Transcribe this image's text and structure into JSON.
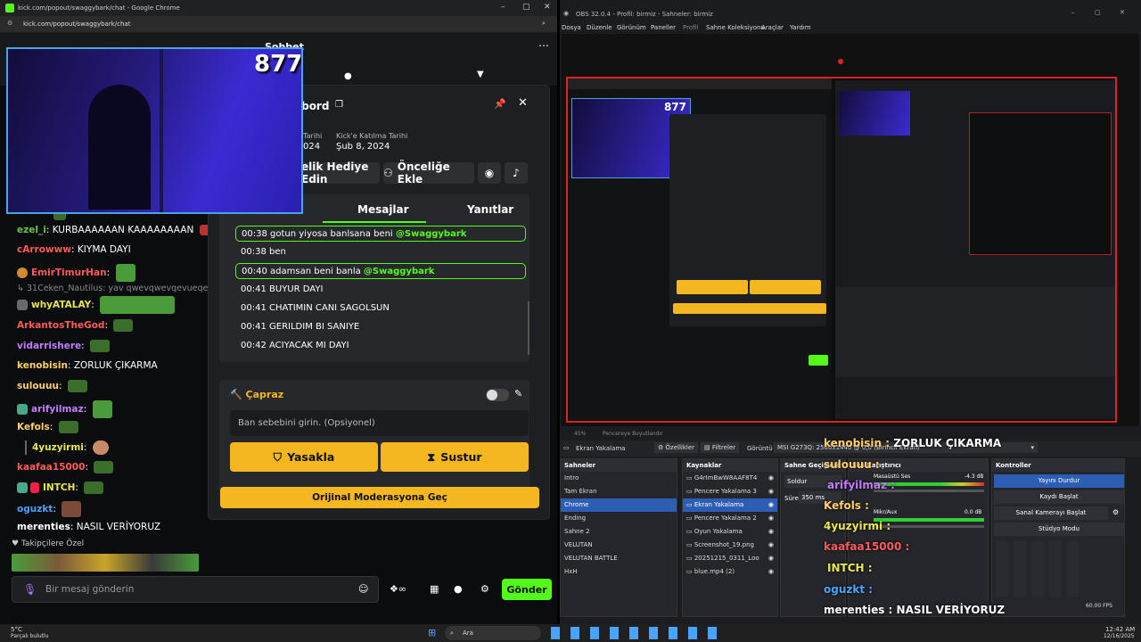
{
  "chrome": {
    "title": "kick.com/popout/swaggybark/chat - Google Chrome",
    "url": "kick.com/popout/swaggybark/chat"
  },
  "kick": {
    "chat_title": "Sohbet",
    "viewer_count": "877",
    "profile": {
      "username_partial": "abord",
      "join_label": "Kick'e Katılma Tarihi",
      "join_date": "Şub 8, 2024",
      "prev_label_partial": "Tarihi",
      "prev_value_partial": "024"
    },
    "actions": {
      "gift": "elik Hediye Edin",
      "priority": "Önceliğe Ekle"
    },
    "tabs": {
      "messages": "Mesajlar",
      "replies": "Yanıtlar"
    },
    "log": [
      {
        "time": "00:38",
        "text": "gotun yiyosa banlsana beni",
        "mention": "@Swaggybark",
        "highlight": true
      },
      {
        "time": "00:38",
        "text": "ben",
        "mention": "",
        "highlight": false
      },
      {
        "time": "00:40",
        "text": "adamsan beni banla",
        "mention": "@Swaggybark",
        "highlight": true
      },
      {
        "time": "00:41",
        "text": "BUYUR DAYI",
        "mention": "",
        "highlight": false
      },
      {
        "time": "00:41",
        "text": "CHATIMIN CANI SAGOLSUN",
        "mention": "",
        "highlight": false
      },
      {
        "time": "00:41",
        "text": "GERILDIM BI SANIYE",
        "mention": "",
        "highlight": false
      },
      {
        "time": "00:42",
        "text": "ACIYACAK MI DAYI",
        "mention": "",
        "highlight": false
      }
    ],
    "caprazz": "Çapraz",
    "reason_placeholder": "Ban sebebini girin. (Opsiyonel)",
    "ban": "Yasakla",
    "mute": "Sustur",
    "orig_mod": "Orijinal Moderasyona Geç",
    "chat": [
      {
        "user": "ezel_i",
        "color": "#6cc04a",
        "text": "KURBAAAAAAN KAAAAAAAAN"
      },
      {
        "user": "cArrowww",
        "color": "#ff5a5a",
        "text": "KIYMA DAYI"
      },
      {
        "user": "EmirTimurHan",
        "color": "#ff5a5a",
        "text": ""
      },
      {
        "user": "31Ceken_Nautilus",
        "color": "#888888",
        "text": "yav qwevqwevqevueqeqw is"
      },
      {
        "user": "whyATALAY",
        "color": "#e8e84a",
        "text": ""
      },
      {
        "user": "ArkantosTheGod",
        "color": "#ff5a5a",
        "text": ""
      },
      {
        "user": "vidarrishere",
        "color": "#c27cff",
        "text": ""
      },
      {
        "user": "kenobisin",
        "color": "#ffcf6a",
        "text": "ZORLUK ÇIKARMA"
      },
      {
        "user": "sulouuu",
        "color": "#ffcf6a",
        "text": ""
      },
      {
        "user": "arifyilmaz",
        "color": "#c27cff",
        "text": ""
      },
      {
        "user": "Kefols",
        "color": "#ffcf6a",
        "text": ""
      },
      {
        "user": "4yuzyirmi",
        "color": "#e8e84a",
        "text": ""
      },
      {
        "user": "kaafaa15000",
        "color": "#ff5a5a",
        "text": ""
      },
      {
        "user": "INTCH",
        "color": "#e8e84a",
        "text": ""
      },
      {
        "user": "oguzkt",
        "color": "#4aa3ff",
        "text": ""
      },
      {
        "user": "merenties",
        "color": "#ffffff",
        "text": "NASIL VERİYORUZ"
      }
    ],
    "followers_label": "Takipçilere Özel",
    "input_placeholder": "Bir mesaj gönderin",
    "send": "Gönder"
  },
  "obs": {
    "title": "OBS 32.0.4 - Profil: birmiz - Sahneler: birmiz",
    "menu": [
      "Dosya",
      "Düzenle",
      "Görünüm",
      "Paneller",
      "Profil",
      "Sahne Koleksiyonu",
      "Araçlar",
      "Yardım"
    ],
    "source_bar": {
      "source": "Ekran Yakalama",
      "props": "Özellikler",
      "filters": "Filtreler",
      "display_label": "Görüntü",
      "display_value": "MSI G273Q: 2560x1440 @ 0,0 (Birincil Ekran)"
    },
    "docks": {
      "scenes": {
        "title": "Sahneler",
        "items": [
          "Intro",
          "Tam Ekran",
          "Chrome",
          "Ending",
          "Sahne 2",
          "VELUTAN",
          "VELUTAN BATTLE",
          "HxH"
        ],
        "selected": "Chrome"
      },
      "sources": {
        "title": "Kaynaklar",
        "items": [
          "G4rImBwW8AAF8T4",
          "Pencere Yakalama 3",
          "Ekran Yakalama",
          "Pencere Yakalama 2",
          "Oyun Yakalama",
          "Screenshot_19.png",
          "20251215_0311_Loo",
          "blue.mp4 (2)"
        ],
        "selected": "Ekran Yakalama"
      },
      "transitions": {
        "title": "Sahne Geçişleri",
        "type": "Soldur",
        "duration_label": "Süre",
        "duration": "350 ms"
      },
      "audio": {
        "title": "Ses Karıştırıcı",
        "mic": "Masaüstü Ses",
        "mic_db": "-4.3 dB",
        "aux": "Mikr/Aux",
        "aux_db": "0.0 dB"
      },
      "controls": {
        "title": "Kontroller",
        "stream": "Yayını Durdur",
        "record": "Kaydı Başlat",
        "vcam": "Sanal Kamerayı Başlat",
        "studio": "Stüdyo Modu"
      }
    },
    "overlay_chat": [
      {
        "user": "kenobisin",
        "text": "ZORLUK ÇIKARMA"
      },
      {
        "user": "sulouuu",
        "text": ""
      },
      {
        "user": "arifyilmaz",
        "text": ""
      },
      {
        "user": "Kefols",
        "text": ""
      },
      {
        "user": "4yuzyirmi",
        "text": ""
      },
      {
        "user": "kaafaa15000",
        "text": ""
      },
      {
        "user": "INTCH",
        "text": ""
      },
      {
        "user": "oguzkt",
        "text": ""
      },
      {
        "user": "merenties",
        "text": "NASIL VERİYORUZ"
      }
    ],
    "fps": "60.00 FPS",
    "zoom": "45%",
    "fit_label": "Pencereye Boyutlandır"
  },
  "taskbar": {
    "weather_temp": "5°C",
    "weather_desc": "Parçalı bulutlu",
    "search": "Ara",
    "time": "12:42 AM",
    "date": "12/16/2025"
  },
  "colors": {
    "kick_green": "#53fc18",
    "accent_yellow": "#f4b71f",
    "obs_select": "#2c5fb3"
  }
}
